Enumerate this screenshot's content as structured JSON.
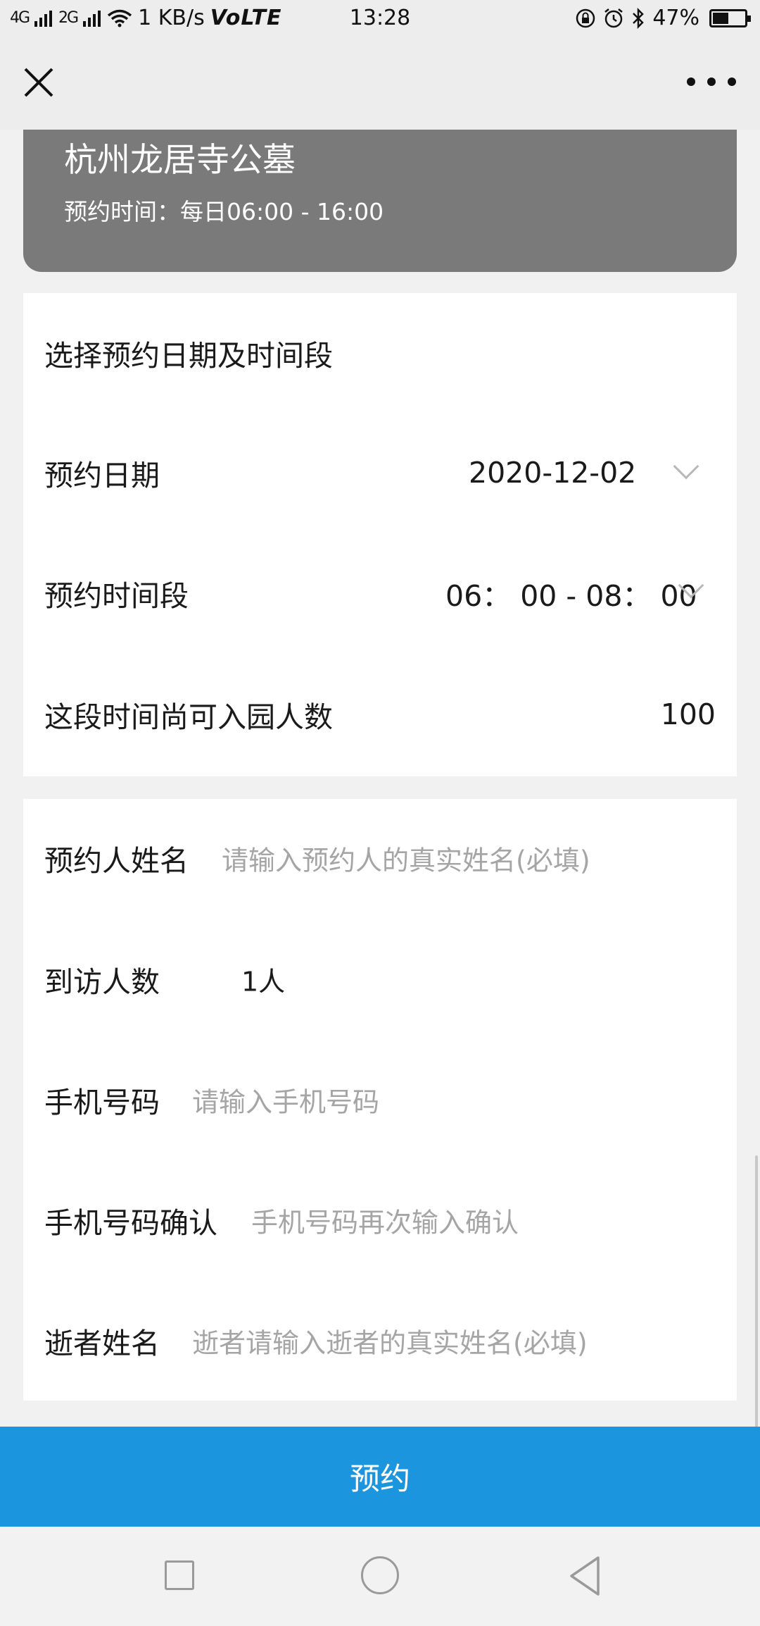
{
  "status_bar": {
    "signal_1": "4G",
    "signal_2": "2G",
    "speed": "1 KB/s",
    "network": "VoLTE",
    "time": "13:28",
    "battery": "47%",
    "battery_level": 0.47
  },
  "nav": {
    "close_icon": "close-icon",
    "more_icon": "more-icon"
  },
  "header": {
    "title": "杭州龙居寺公墓",
    "hours": "预约时间：每日06:00 - 16:00"
  },
  "schedule": {
    "section_title": "选择预约日期及时间段",
    "date_label": "预约日期",
    "date_value": "2020-12-02",
    "slot_label": "预约时间段",
    "slot_value": "06： 00 - 08： 00",
    "capacity_label": "这段时间尚可入园人数",
    "capacity_value": "100"
  },
  "form": {
    "name_label": "预约人姓名",
    "name_placeholder": "请输入预约人的真实姓名(必填)",
    "visitors_label": "到访人数",
    "visitors_value": "1人",
    "phone_label": "手机号码",
    "phone_placeholder": "请输入手机号码",
    "phone_confirm_label": "手机号码确认",
    "phone_confirm_placeholder": "手机号码再次输入确认",
    "deceased_label": "逝者姓名",
    "deceased_placeholder": "逝者请输入逝者的真实姓名(必填)"
  },
  "submit_label": "预约",
  "colors": {
    "accent": "#1a95de",
    "header_bg": "#7a7a7a",
    "placeholder": "#a5a5a5"
  }
}
